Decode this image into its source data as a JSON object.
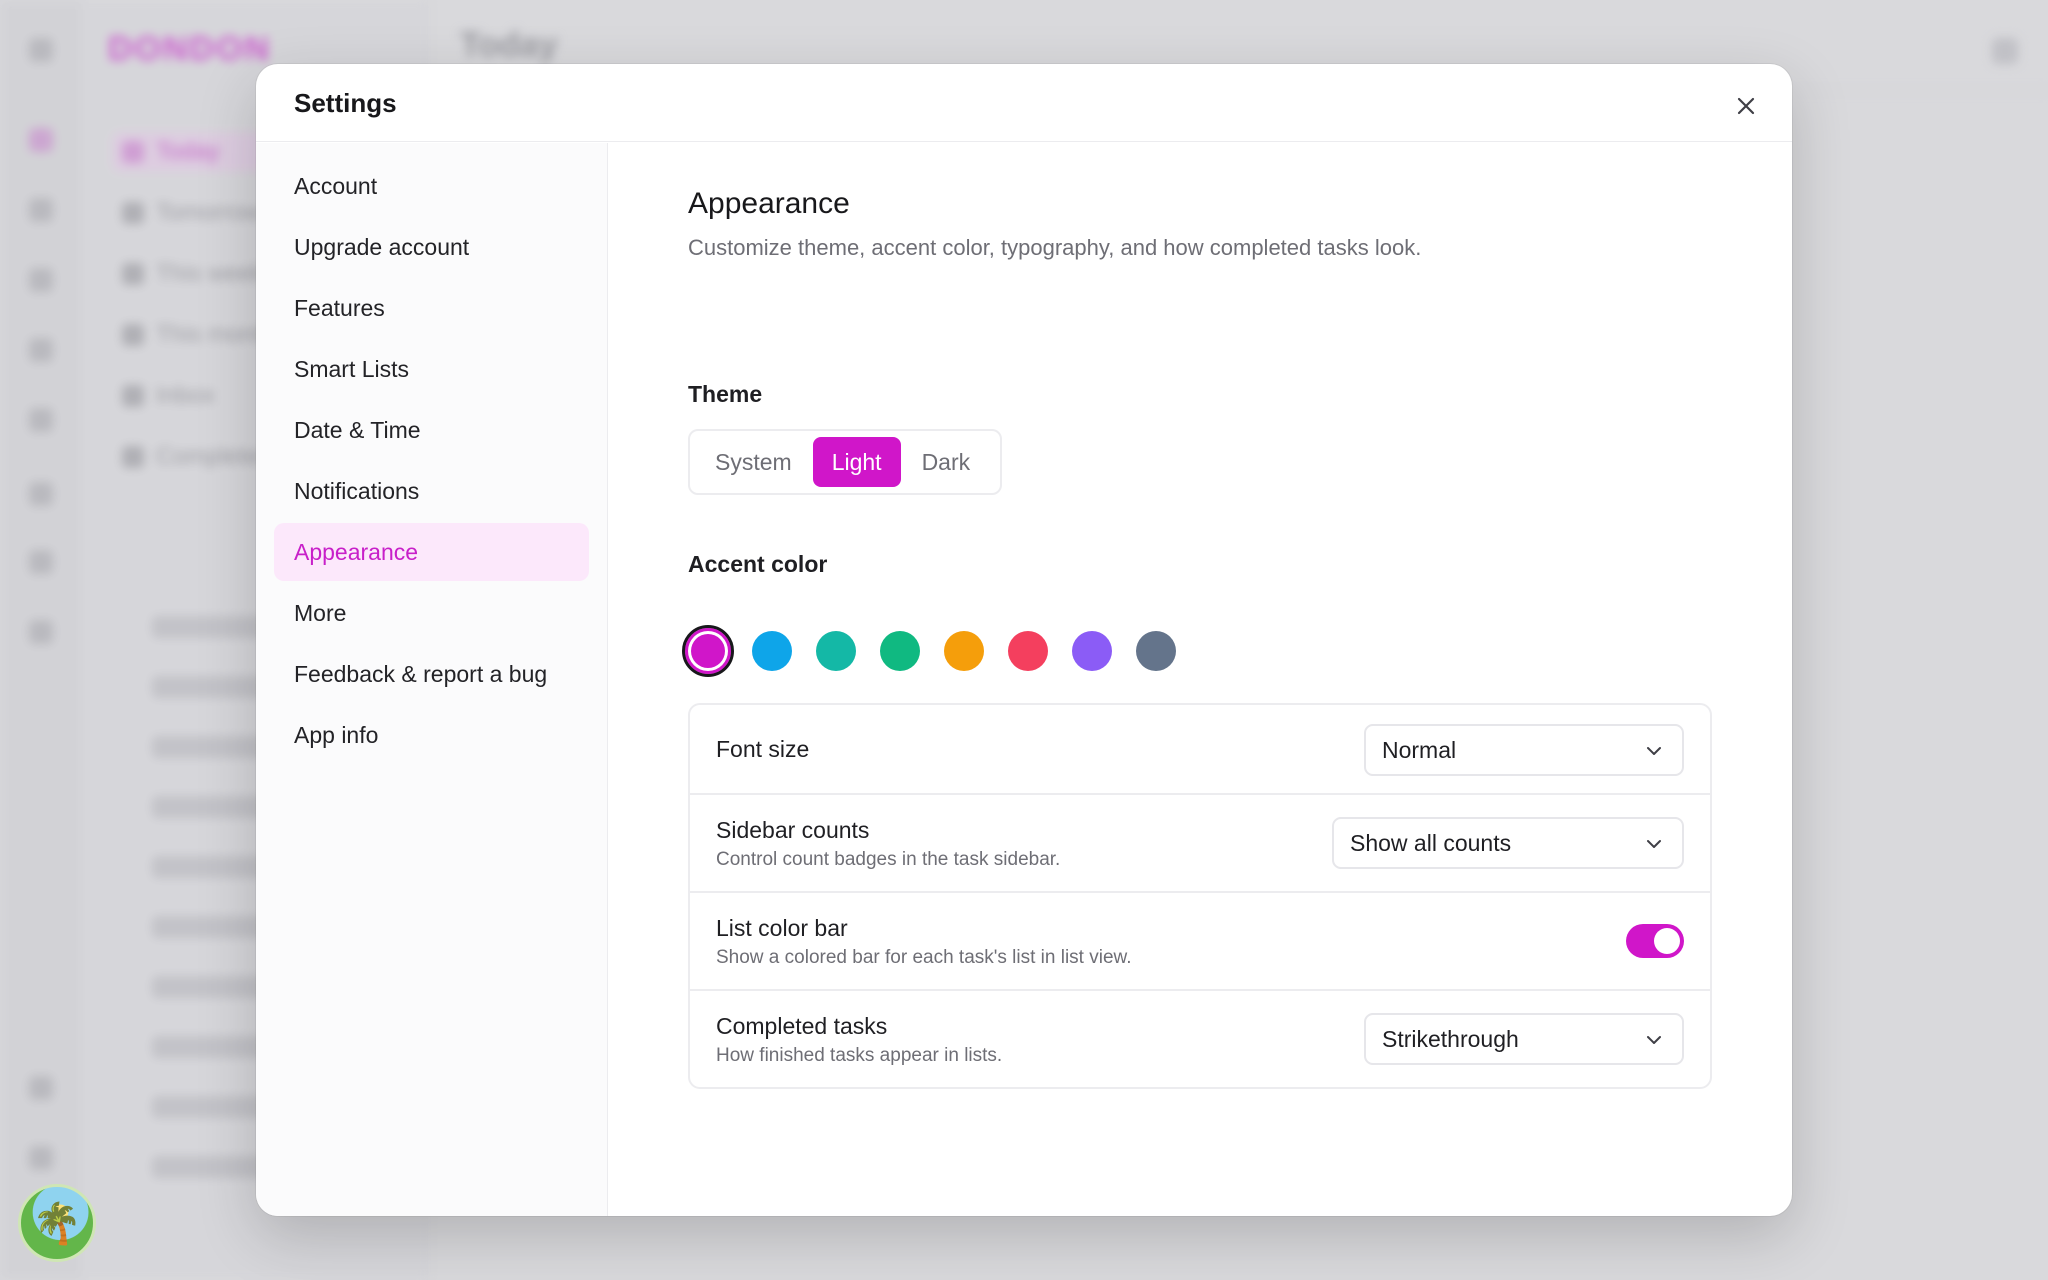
{
  "background": {
    "logo": "DONDON",
    "main_title": "Today",
    "nav_items": [
      "Today",
      "Tomorrow",
      "This week",
      "This month",
      "Inbox",
      "Completed"
    ]
  },
  "modal": {
    "title": "Settings",
    "close_icon": "close-icon"
  },
  "nav": {
    "items": [
      {
        "label": "Account",
        "active": false
      },
      {
        "label": "Upgrade account",
        "active": false
      },
      {
        "label": "Features",
        "active": false
      },
      {
        "label": "Smart Lists",
        "active": false
      },
      {
        "label": "Date & Time",
        "active": false
      },
      {
        "label": "Notifications",
        "active": false
      },
      {
        "label": "Appearance",
        "active": true
      },
      {
        "label": "More",
        "active": false
      },
      {
        "label": "Feedback & report a bug",
        "active": false
      },
      {
        "label": "App info",
        "active": false
      }
    ]
  },
  "appearance": {
    "title": "Appearance",
    "description": "Customize theme, accent color, typography, and how completed tasks look.",
    "theme_label": "Theme",
    "theme_options": [
      {
        "label": "System",
        "selected": false
      },
      {
        "label": "Light",
        "selected": true
      },
      {
        "label": "Dark",
        "selected": false
      }
    ],
    "accent_label": "Accent color",
    "accent_colors": [
      {
        "name": "magenta",
        "hex": "#d016c9",
        "selected": true
      },
      {
        "name": "blue",
        "hex": "#0ea5e9",
        "selected": false
      },
      {
        "name": "teal",
        "hex": "#14b8a6",
        "selected": false
      },
      {
        "name": "green",
        "hex": "#10b981",
        "selected": false
      },
      {
        "name": "orange",
        "hex": "#f59e0b",
        "selected": false
      },
      {
        "name": "red",
        "hex": "#f43f5e",
        "selected": false
      },
      {
        "name": "purple",
        "hex": "#8b5cf6",
        "selected": false
      },
      {
        "name": "slate",
        "hex": "#64748b",
        "selected": false
      }
    ],
    "font_size": {
      "title": "Font size",
      "value": "Normal"
    },
    "sidebar_counts": {
      "title": "Sidebar counts",
      "subtitle": "Control count badges in the task sidebar.",
      "value": "Show all counts"
    },
    "list_color_bar": {
      "title": "List color bar",
      "subtitle": "Show a colored bar for each task's list in list view.",
      "enabled": true
    },
    "completed_tasks": {
      "title": "Completed tasks",
      "subtitle": "How finished tasks appear in lists.",
      "value": "Strikethrough"
    }
  },
  "colors": {
    "accent": "#d016c9",
    "accent_soft": "#fce8fb"
  }
}
